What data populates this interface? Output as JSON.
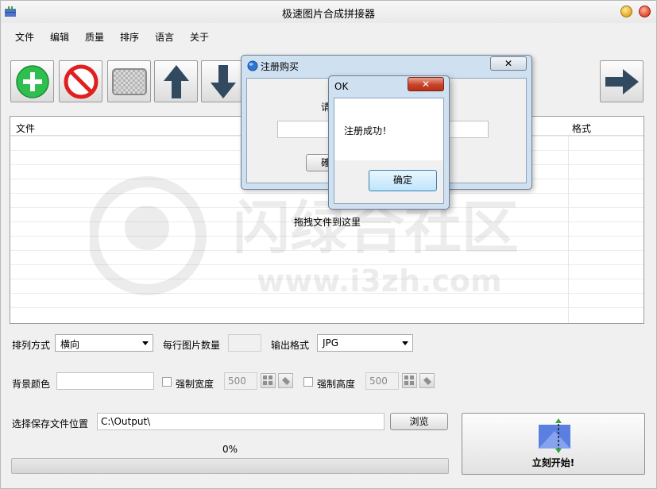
{
  "window": {
    "title": "极速图片合成拼接器"
  },
  "menu": [
    "文件",
    "编辑",
    "质量",
    "排序",
    "语言",
    "关于"
  ],
  "toolbar": {
    "buttons": [
      "add-icon",
      "remove-icon",
      "clear-icon",
      "move-up-icon",
      "move-down-icon",
      "next-icon"
    ]
  },
  "file_list": {
    "columns": [
      "文件",
      "格式"
    ],
    "drop_hint": "拖拽文件到这里"
  },
  "watermark": {
    "text_cn": "闪绿合社区",
    "text_url": "www.i3zh.com"
  },
  "options": {
    "arrange_label": "排列方式",
    "arrange_value": "横向",
    "per_row_label": "每行图片数量",
    "per_row_value": "",
    "output_format_label": "输出格式",
    "output_format_value": "JPG",
    "bg_color_label": "背景颜色",
    "bg_color_value": "",
    "force_width_label": "强制宽度",
    "force_width_value": "500",
    "force_height_label": "强制高度",
    "force_height_value": "500",
    "save_path_label": "选择保存文件位置",
    "save_path_value": "C:\\Output\\",
    "browse_label": "浏览"
  },
  "progress": {
    "label": "0%",
    "fraction": 0
  },
  "start": {
    "label": "立刻开始!"
  },
  "register_dialog": {
    "title": "注册购买",
    "prompt_partial": "请",
    "button_partial": "確"
  },
  "ok_dialog": {
    "title": "OK",
    "message": "注册成功！",
    "confirm_label": "确定"
  }
}
